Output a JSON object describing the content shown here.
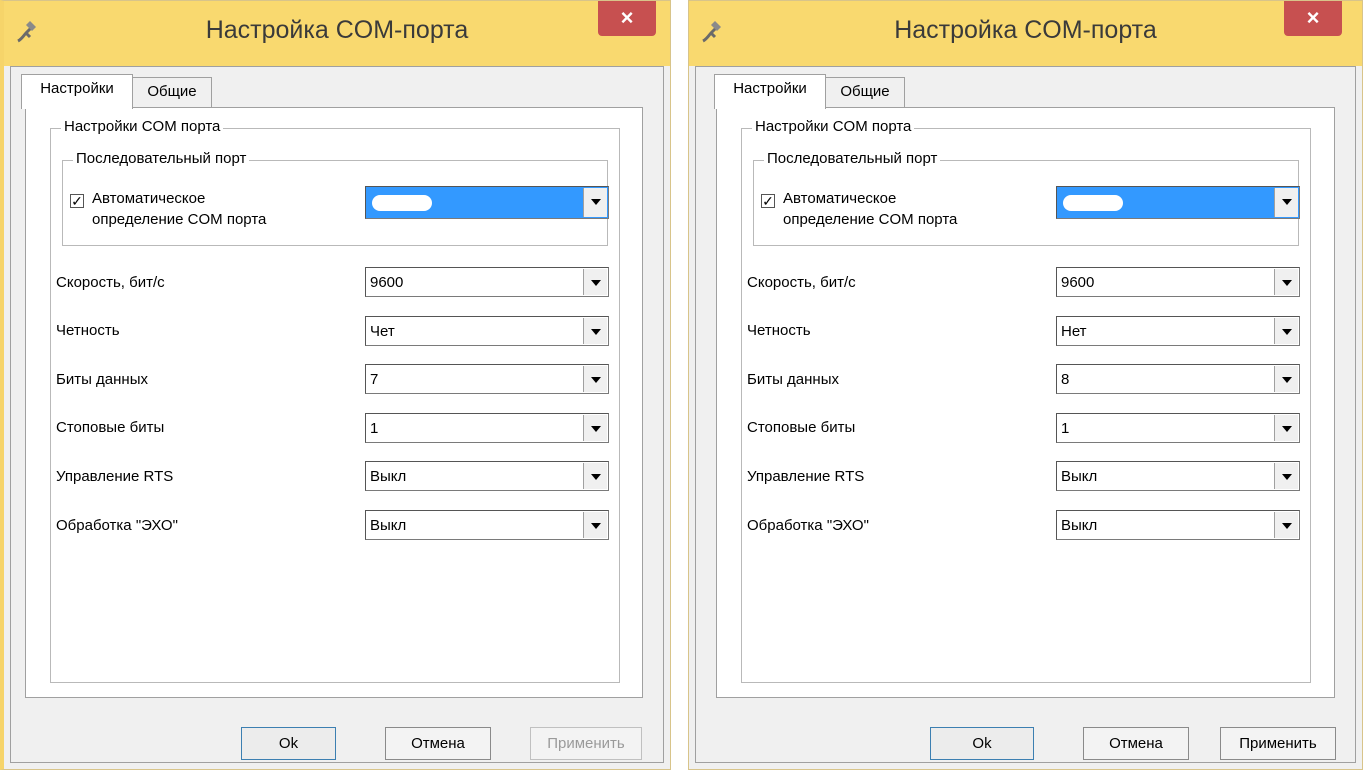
{
  "windows": [
    {
      "title": "Настройка COM-порта",
      "close_label": "×",
      "tabs": [
        "Настройки",
        "Общие"
      ],
      "group_label": "Настройки COM порта",
      "serial_group_label": "Последовательный порт",
      "auto_checkbox": {
        "checked": true,
        "label_line1": "Автоматическое",
        "label_line2": "определение COM порта"
      },
      "fields": [
        {
          "label": "Скорость, бит/с",
          "value": "9600"
        },
        {
          "label": "Четность",
          "value": "Чет"
        },
        {
          "label": "Биты данных",
          "value": "7"
        },
        {
          "label": "Стоповые биты",
          "value": "1"
        },
        {
          "label": "Управление RTS",
          "value": "Выкл"
        },
        {
          "label": "Обработка \"ЭХО\"",
          "value": "Выкл"
        }
      ],
      "buttons": {
        "ok": "Ok",
        "cancel": "Отмена",
        "apply": "Применить",
        "apply_enabled": false
      }
    },
    {
      "title": "Настройка COM-порта",
      "close_label": "×",
      "tabs": [
        "Настройки",
        "Общие"
      ],
      "group_label": "Настройки COM порта",
      "serial_group_label": "Последовательный порт",
      "auto_checkbox": {
        "checked": true,
        "label_line1": "Автоматическое",
        "label_line2": "определение COM порта"
      },
      "fields": [
        {
          "label": "Скорость, бит/с",
          "value": "9600"
        },
        {
          "label": "Четность",
          "value": "Нет"
        },
        {
          "label": "Биты данных",
          "value": "8"
        },
        {
          "label": "Стоповые биты",
          "value": "1"
        },
        {
          "label": "Управление RTS",
          "value": "Выкл"
        },
        {
          "label": "Обработка \"ЭХО\"",
          "value": "Выкл"
        }
      ],
      "buttons": {
        "ok": "Ok",
        "cancel": "Отмена",
        "apply": "Применить",
        "apply_enabled": true
      }
    }
  ],
  "colors": {
    "titlebar": "#f9d96f",
    "close": "#c75050",
    "port_selected": "#3399ff"
  },
  "icons": {
    "app": "plug-icon",
    "close": "close-icon",
    "dropdown": "chevron-down-icon"
  }
}
